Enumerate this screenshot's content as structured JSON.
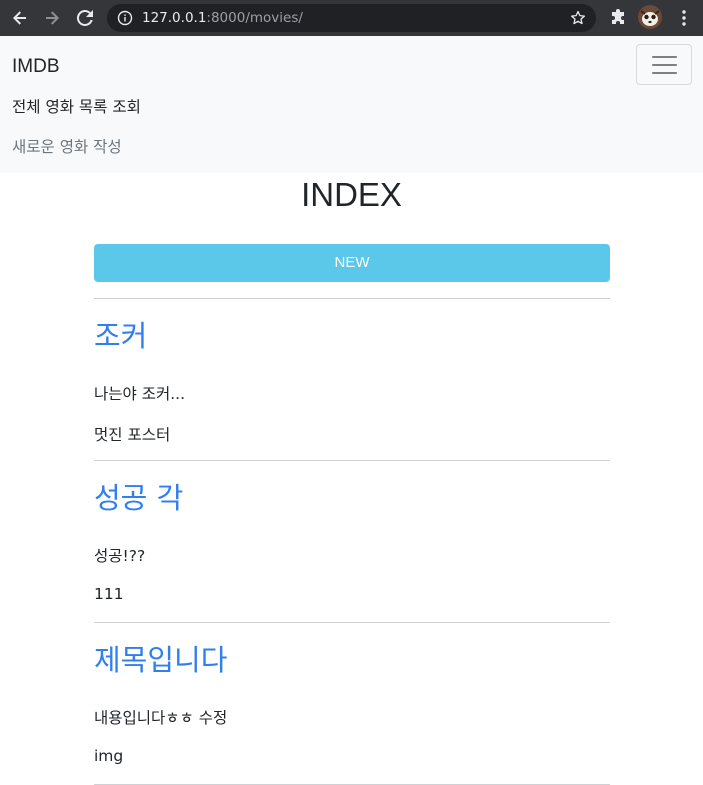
{
  "browser": {
    "url_host": "127.0.0.1",
    "url_rest": ":8000/movies/"
  },
  "navbar": {
    "brand": "IMDB",
    "links": [
      "전체 영화 목록 조회",
      "새로운 영화 작성"
    ]
  },
  "page": {
    "title": "INDEX",
    "new_button": "NEW"
  },
  "movies": [
    {
      "title": "조커",
      "description": "나는야 조커...",
      "poster": "멋진 포스터"
    },
    {
      "title": "성공 각",
      "description": "성공!??",
      "poster": "111"
    },
    {
      "title": "제목입니다",
      "description": "내용입니다ㅎㅎ 수정",
      "poster": "img"
    }
  ],
  "colors": {
    "navbar_bg": "#f8f9fa",
    "accent_info": "#5bc8ea",
    "link_blue": "#2f7ff0"
  }
}
